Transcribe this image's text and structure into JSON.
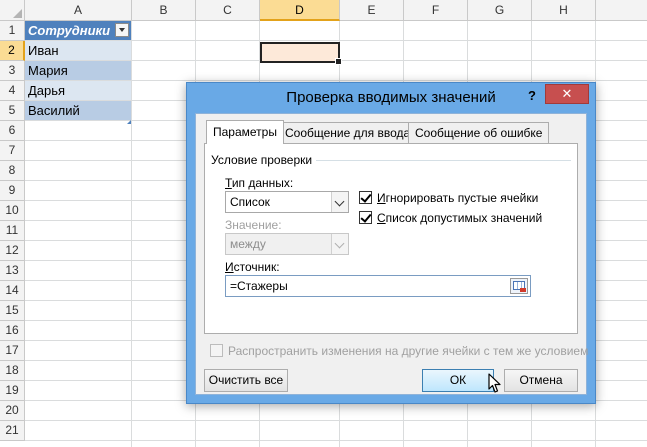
{
  "sheet": {
    "columns": [
      "A",
      "B",
      "C",
      "D",
      "E",
      "F",
      "G",
      "H"
    ],
    "active_column": "D",
    "rows": [
      "1",
      "2",
      "3",
      "4",
      "5",
      "6",
      "7",
      "8",
      "9",
      "10",
      "11",
      "12",
      "13",
      "14",
      "15",
      "16",
      "17",
      "18",
      "19",
      "20",
      "21"
    ],
    "active_row": "2",
    "table": {
      "header": "Сотрудники",
      "values": [
        "Иван",
        "Мария",
        "Дарья",
        "Василий"
      ]
    }
  },
  "dialog": {
    "title": "Проверка вводимых значений",
    "help_label": "?",
    "close_label": "✕",
    "tabs": [
      {
        "label": "Параметры",
        "active": true
      },
      {
        "label": "Сообщение для ввода",
        "active": false
      },
      {
        "label": "Сообщение об ошибке",
        "active": false
      }
    ],
    "group_title": "Условие проверки",
    "data_type_label_u": "Т",
    "data_type_label_rest": "ип данных:",
    "data_type_value": "Список",
    "value_label": "Значение:",
    "value_value": "между",
    "ignore_blank_u": "И",
    "ignore_blank_rest": "гнорировать пустые ячейки",
    "ignore_blank_checked": true,
    "dropdown_u": "С",
    "dropdown_rest": "писок допустимых значений",
    "dropdown_checked": true,
    "source_label_u": "И",
    "source_label_rest": "сточник:",
    "source_value": "=Стажеры",
    "apply_all_label": "Распространить изменения на другие ячейки с тем же условием",
    "apply_all_checked": false,
    "clear_button": "Очистить все",
    "ok_button": "ОК",
    "cancel_button": "Отмена"
  },
  "colors": {
    "table_header": "#4f81bd",
    "table_band_light": "#dce6f1",
    "table_band_dark": "#b8cce4",
    "selected_cell_fill": "#fde9d9",
    "dialog_frame": "#69a9e6",
    "close_button": "#c74f4f"
  }
}
